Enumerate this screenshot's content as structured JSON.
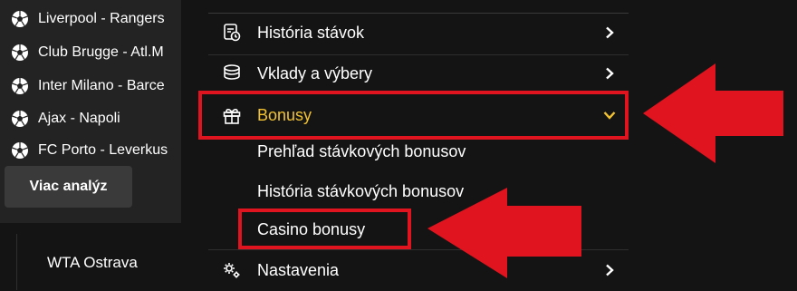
{
  "matches": [
    {
      "label": "Liverpool - Rangers"
    },
    {
      "label": "Club Brugge - Atl.M"
    },
    {
      "label": "Inter Milano - Barce"
    },
    {
      "label": "Ajax - Napoli"
    },
    {
      "label": "FC Porto - Leverkus"
    }
  ],
  "more_button": "Viac analýz",
  "tournament": "WTA Ostrava",
  "menu": {
    "history": "História stávok",
    "deposits": "Vklady a výbery",
    "bonuses": "Bonusy",
    "bonuses_sub": [
      {
        "label": "Prehľad stávkových bonusov"
      },
      {
        "label": "História stávkových bonusov"
      },
      {
        "label": "Casino bonusy"
      }
    ],
    "settings": "Nastavenia"
  },
  "colors": {
    "accent_yellow": "#f2c232",
    "highlight_red": "#e0141e"
  }
}
